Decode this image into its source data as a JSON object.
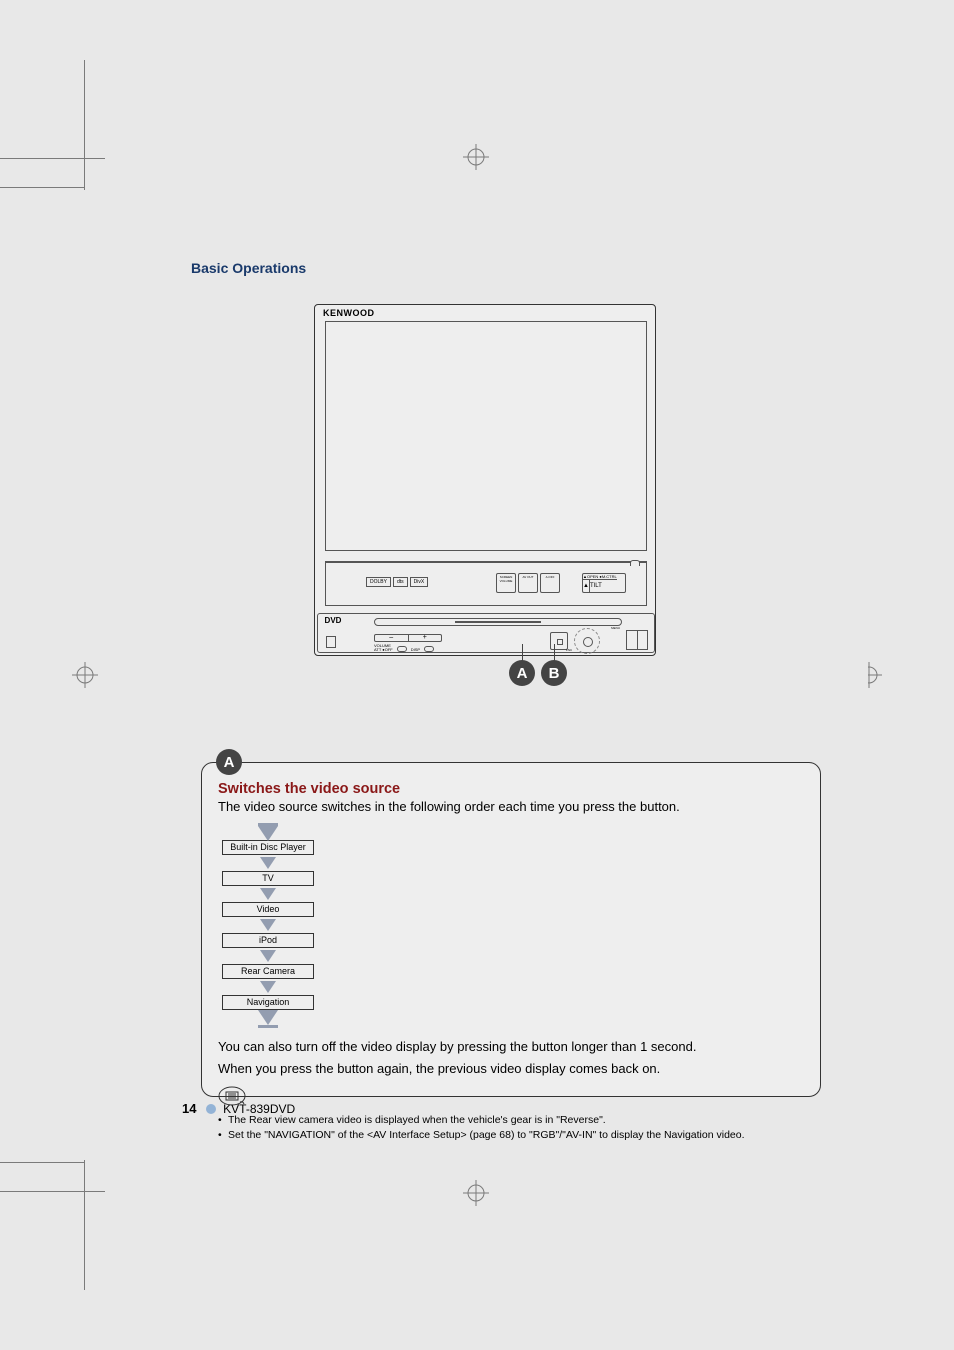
{
  "header": "Basic Operations",
  "product": {
    "brand": "KENWOOD",
    "panel_labels": {
      "screen_volume": "SCREEN VOLUME",
      "avout": "AV OUT",
      "aoff": "A.OFF",
      "open_close": "▲OPEN  ●M.CTRL",
      "open": "▲",
      "tilt": "TILT"
    },
    "base_labels": {
      "dvd": "DVD",
      "volume": "VOLUME",
      "att_off": "ATT ●OFF",
      "disp": "DISP",
      "vsel": "V.SEL",
      "nav": "NAV",
      "fnc": "FNC",
      "menu": "MENU",
      "return": "RETURN"
    }
  },
  "callouts": {
    "a": "A",
    "b": "B"
  },
  "section": {
    "tag": "A",
    "title": "Switches the video source",
    "lead": "The video source switches in the following order each time you press the button.",
    "flow": [
      "Built-in Disc Player",
      "TV",
      "Video",
      "iPod",
      "Rear Camera",
      "Navigation"
    ],
    "para1": "You can also turn off the video display by pressing the button longer than 1 second.",
    "para2": "When you press the button again, the previous video display comes back on.",
    "notes": [
      "The Rear view camera video is displayed when the vehicle's gear is in \"Reverse\".",
      "Set the \"NAVIGATION\" of the <AV Interface Setup> (page 68) to \"RGB\"/\"AV-IN\" to display the Navigation video."
    ]
  },
  "footer": {
    "page": "14",
    "model": "KVT-839DVD"
  }
}
